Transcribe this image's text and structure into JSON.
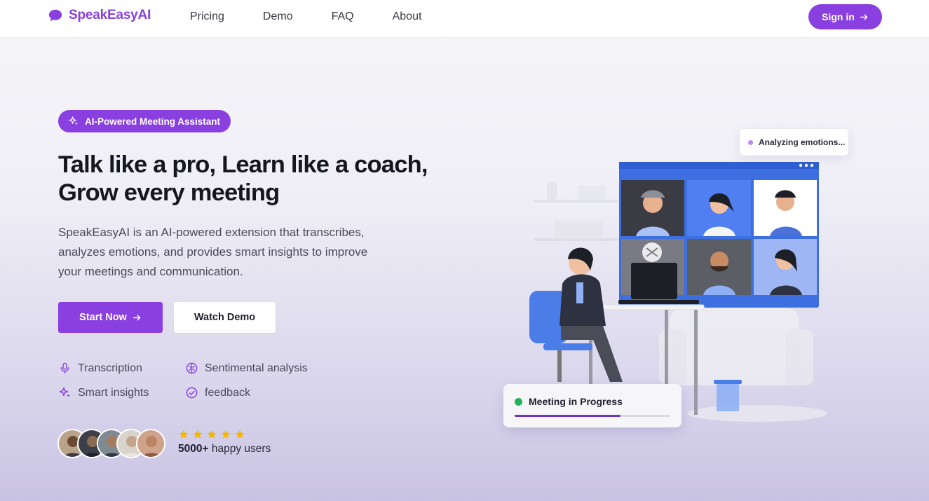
{
  "brand": {
    "name": "SpeakEasyAI",
    "accent": "#8a3fe0"
  },
  "nav": {
    "links": [
      "Pricing",
      "Demo",
      "FAQ",
      "About"
    ],
    "signin_label": "Sign in"
  },
  "hero": {
    "badge": "AI-Powered Meeting Assistant",
    "title_line1": "Talk like a pro, Learn like a coach,",
    "title_line2": "Grow every meeting",
    "description": "SpeakEasyAI is an AI-powered extension that transcribes, analyzes emotions, and provides smart insights to improve your meetings and communication.",
    "start_label": "Start Now",
    "demo_label": "Watch Demo"
  },
  "features": [
    {
      "label": "Transcription",
      "icon": "microphone-icon"
    },
    {
      "label": "Sentimental analysis",
      "icon": "brain-icon"
    },
    {
      "label": "Smart insights",
      "icon": "sparkles-icon"
    },
    {
      "label": "feedback",
      "icon": "check-circle-icon"
    }
  ],
  "social_proof": {
    "rating": 5,
    "count": "5000+",
    "suffix": "happy users"
  },
  "illustration": {
    "analyzing_label": "Analyzing emotions...",
    "meeting_label": "Meeting in Progress",
    "meeting_progress": 0.68
  }
}
